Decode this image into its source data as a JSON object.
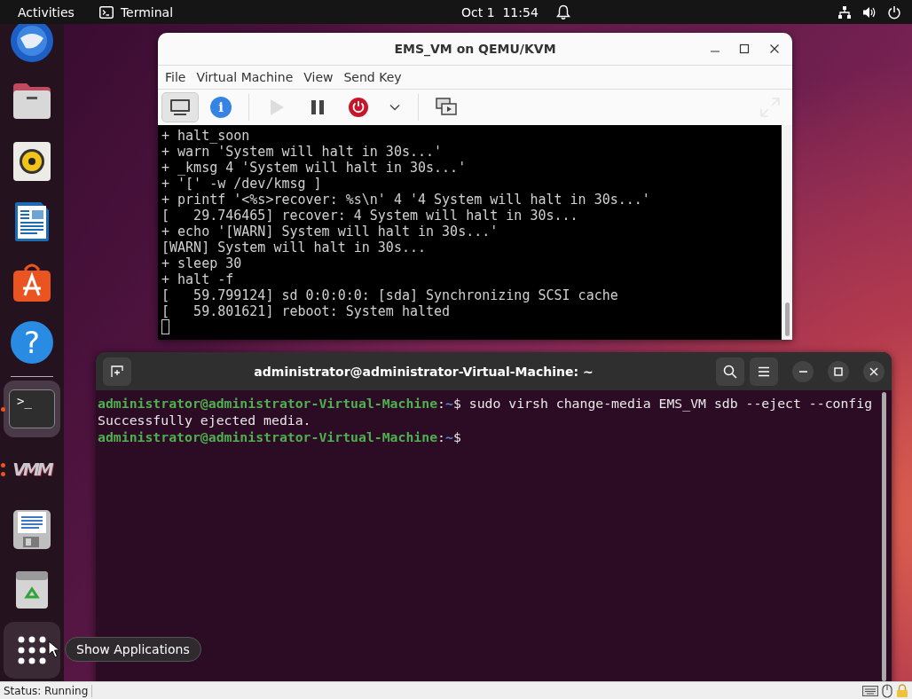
{
  "top_bar": {
    "activities": "Activities",
    "app_menu": "Terminal",
    "clock": "Oct 1  11:54"
  },
  "dock": {
    "items": [
      {
        "kind": "mail",
        "running": false,
        "focused": false
      },
      {
        "kind": "files",
        "running": false,
        "focused": false
      },
      {
        "kind": "music",
        "running": false,
        "focused": false
      },
      {
        "kind": "writer",
        "running": false,
        "focused": false
      },
      {
        "kind": "store",
        "running": false,
        "focused": false
      },
      {
        "kind": "help",
        "glyph": "?",
        "running": false,
        "focused": false
      },
      {
        "kind": "separator"
      },
      {
        "kind": "terminal",
        "glyph": ">_",
        "running": true,
        "multi_window": false,
        "focused": true
      },
      {
        "kind": "vmm",
        "glyph": "VMM",
        "running": true,
        "multi_window": true,
        "focused": false
      },
      {
        "kind": "editor",
        "running": false,
        "focused": false
      },
      {
        "kind": "trash",
        "running": false,
        "focused": false
      }
    ],
    "apps_button": {
      "tooltip": "Show Applications"
    }
  },
  "vm_window": {
    "title": "EMS_VM on QEMU/KVM",
    "menu": [
      "File",
      "Virtual Machine",
      "View",
      "Send Key"
    ],
    "toolbar": [
      {
        "kind": "console",
        "selected": true,
        "disabled": false
      },
      {
        "kind": "details",
        "glyph": "i",
        "selected": false,
        "disabled": false
      },
      {
        "kind": "separator"
      },
      {
        "kind": "run",
        "selected": false,
        "disabled": true
      },
      {
        "kind": "pause",
        "selected": false,
        "disabled": false
      },
      {
        "kind": "shutdown",
        "selected": false,
        "disabled": false
      },
      {
        "kind": "caret",
        "selected": false,
        "disabled": false
      },
      {
        "kind": "separator"
      },
      {
        "kind": "snapshots",
        "selected": false,
        "disabled": false
      },
      {
        "kind": "fullscreen",
        "selected": false,
        "disabled": true
      }
    ],
    "console_lines": [
      "+ halt_soon",
      "+ warn 'System will halt in 30s...'",
      "+ _kmsg 4 'System will halt in 30s...'",
      "+ '[' -w /dev/kmsg ]",
      "+ printf '<%s>recover: %s\\n' 4 '4 System will halt in 30s...'",
      "[   29.746465] recover: 4 System will halt in 30s...",
      "+ echo '[WARN] System will halt in 30s...'",
      "[WARN] System will halt in 30s...",
      "+ sleep 30",
      "+ halt -f",
      "[   59.799124] sd 0:0:0:0: [sda] Synchronizing SCSI cache",
      "[   59.801621] reboot: System halted"
    ]
  },
  "terminal_window": {
    "title": "administrator@administrator-Virtual-Machine: ~",
    "lines": [
      {
        "kind": "prompt",
        "user_host": "administrator@administrator-Virtual-Machine",
        "separator": ":",
        "path": "~",
        "symbol": "$",
        "command": "sudo virsh change-media EMS_VM sdb --eject --config"
      },
      {
        "kind": "output",
        "text": "Successfully ejected media."
      },
      {
        "kind": "prompt",
        "user_host": "administrator@administrator-Virtual-Machine",
        "separator": ":",
        "path": "~",
        "symbol": "$"
      }
    ]
  },
  "status_bar": {
    "status": "Status: Running"
  }
}
